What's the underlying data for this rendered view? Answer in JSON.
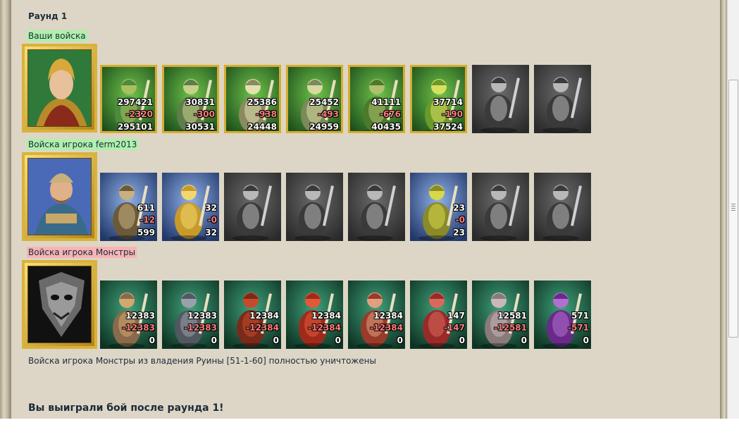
{
  "round_title": "Раунд 1",
  "sections": [
    {
      "label": "Ваши войска",
      "label_color": "#aef0ac",
      "hero": {
        "icon": "knight-hero-portrait",
        "frame": "gold"
      },
      "units": [
        {
          "icon": "dwarf-warrior",
          "start": "297421",
          "loss": "-2320",
          "end": "295101",
          "framed": true,
          "grey": false
        },
        {
          "icon": "armored-swordsman",
          "start": "30831",
          "loss": "-300",
          "end": "30531",
          "framed": true,
          "grey": false
        },
        {
          "icon": "knight-with-shield",
          "start": "25386",
          "loss": "-938",
          "end": "24448",
          "framed": true,
          "grey": false
        },
        {
          "icon": "winged-griffin-rider",
          "start": "25452",
          "loss": "-493",
          "end": "24959",
          "framed": true,
          "grey": false
        },
        {
          "icon": "elf-archer",
          "start": "41111",
          "loss": "-676",
          "end": "40435",
          "framed": true,
          "grey": false
        },
        {
          "icon": "druid-mage",
          "start": "37714",
          "loss": "-190",
          "end": "37524",
          "framed": true,
          "grey": false
        },
        {
          "icon": "hooded-warrior",
          "start": "",
          "loss": "",
          "end": "",
          "framed": false,
          "grey": true
        },
        {
          "icon": "robed-elder",
          "start": "",
          "loss": "",
          "end": "",
          "framed": false,
          "grey": true
        }
      ]
    },
    {
      "label": "Войска игрока ferm2013",
      "label_color": "#aef0ac",
      "hero": {
        "icon": "peasant-hero-portrait",
        "frame": "gold"
      },
      "units": [
        {
          "icon": "peasant-with-donkey",
          "start": "611",
          "loss": "-12",
          "end": "599",
          "framed": false,
          "grey": false
        },
        {
          "icon": "golden-swordsman",
          "start": "32",
          "loss": "-0",
          "end": "32",
          "framed": false,
          "grey": false
        },
        {
          "icon": "horse-rider",
          "start": "",
          "loss": "",
          "end": "",
          "framed": false,
          "grey": true
        },
        {
          "icon": "pegasus",
          "start": "",
          "loss": "",
          "end": "",
          "framed": false,
          "grey": true
        },
        {
          "icon": "crossbowman",
          "start": "",
          "loss": "",
          "end": "",
          "framed": false,
          "grey": true
        },
        {
          "icon": "hooded-monk",
          "start": "23",
          "loss": "-0",
          "end": "23",
          "framed": false,
          "grey": false
        },
        {
          "icon": "armored-guard",
          "start": "",
          "loss": "",
          "end": "",
          "framed": false,
          "grey": true
        },
        {
          "icon": "cloaked-rider",
          "start": "",
          "loss": "",
          "end": "",
          "framed": false,
          "grey": true
        }
      ]
    },
    {
      "label": "Войска игрока Монстры",
      "label_color": "#f6b4b4",
      "hero": {
        "icon": "monster-mask-portrait",
        "frame": "gold"
      },
      "units": [
        {
          "icon": "serpent-beast",
          "start": "12383",
          "loss": "-12383",
          "end": "0",
          "framed": false,
          "grey": false
        },
        {
          "icon": "stone-golem",
          "start": "12383",
          "loss": "-12383",
          "end": "0",
          "framed": false,
          "grey": false
        },
        {
          "icon": "orc-warrior",
          "start": "12384",
          "loss": "-12384",
          "end": "0",
          "framed": false,
          "grey": false
        },
        {
          "icon": "red-demon",
          "start": "12384",
          "loss": "-12384",
          "end": "0",
          "framed": false,
          "grey": false
        },
        {
          "icon": "spiked-beast",
          "start": "12384",
          "loss": "-12384",
          "end": "0",
          "framed": false,
          "grey": false
        },
        {
          "icon": "red-shaman",
          "start": "147",
          "loss": "-147",
          "end": "0",
          "framed": false,
          "grey": false
        },
        {
          "icon": "tomb-stone-creature",
          "start": "12581",
          "loss": "-12581",
          "end": "0",
          "framed": false,
          "grey": false
        },
        {
          "icon": "purple-naga",
          "start": "571",
          "loss": "-571",
          "end": "0",
          "framed": false,
          "grey": false
        }
      ]
    }
  ],
  "result_message": "Войска игрока Монстры из владения Руины [51-1-60] полностью уничтожены",
  "victory_message": "Вы выиграли бой после раунда 1!"
}
